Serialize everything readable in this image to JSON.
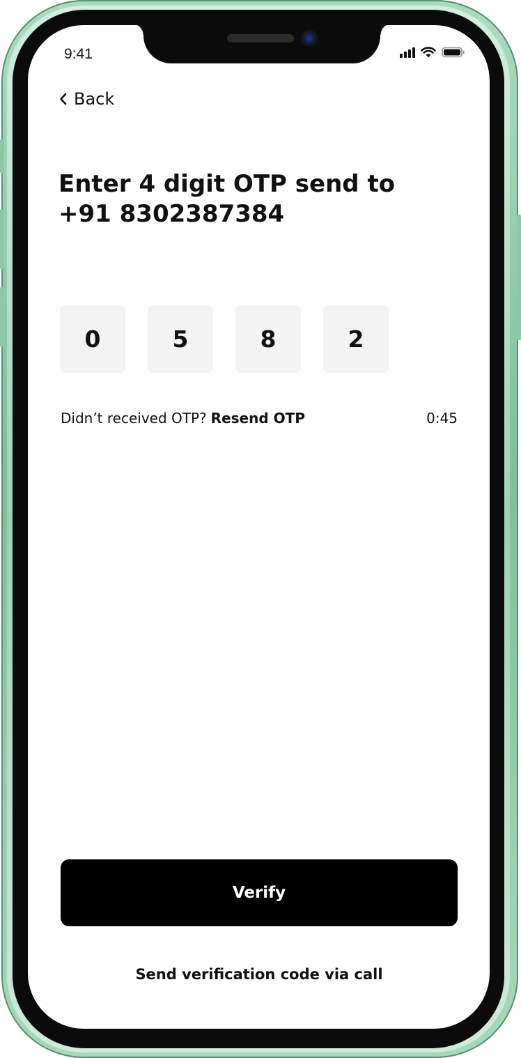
{
  "status_bar": {
    "time": "9:41",
    "icons": [
      "cellular-signal-icon",
      "wifi-icon",
      "battery-icon"
    ]
  },
  "nav": {
    "back_label": "Back",
    "back_icon": "chevron-left-icon"
  },
  "heading": {
    "line1": "Enter 4 digit OTP send to",
    "line2": "+91 8302387384"
  },
  "otp": {
    "digits": [
      "0",
      "5",
      "8",
      "2"
    ]
  },
  "resend": {
    "prompt": "Didn’t received OTP?",
    "link_label": "Resend OTP",
    "timer": "0:45"
  },
  "actions": {
    "verify_label": "Verify",
    "call_label": "Send verification code via call"
  },
  "colors": {
    "frame": "#8fcbaa",
    "primary_button": "#000000",
    "otp_box_bg": "#f3f3f3",
    "text": "#111111"
  }
}
